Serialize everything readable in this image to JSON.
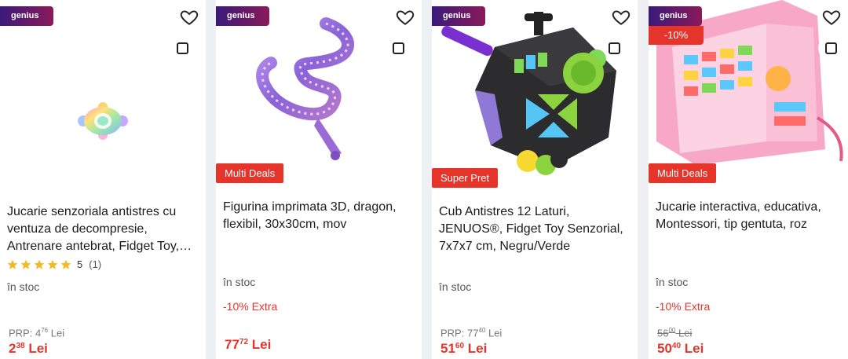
{
  "common": {
    "genius_label": "genius",
    "in_stock": "în stoc",
    "currency": "Lei",
    "prp_label": "PRP:",
    "extra_label": "-10% Extra",
    "colors": {
      "accent": "#e5352b",
      "genius_start": "#3a1a7a",
      "genius_end": "#8a1a5a",
      "star": "#f5b921"
    }
  },
  "products": [
    {
      "title": "Jucarie senzoriala antistres cu ventuza de decompresie, Antrenare antebrat, Fidget Toy, Multicolor",
      "rating": "5",
      "rating_count": "(1)",
      "prp_int": "4",
      "prp_dec": "76",
      "price_int": "2",
      "price_dec": "38",
      "image": "rainbow-pop-fidget-image"
    },
    {
      "title": "Figurina imprimata 3D, dragon, flexibil, 30x30cm, mov",
      "badge": "Multi Deals",
      "price_int": "77",
      "price_dec": "72",
      "image": "purple-dragon-figurine-image"
    },
    {
      "title": "Cub Antistres 12 Laturi, JENUOS®, Fidget Toy Senzorial, 7x7x7 cm, Negru/Verde",
      "badge": "Super Pret",
      "prp_int": "77",
      "prp_dec": "40",
      "price_int": "51",
      "price_dec": "60",
      "image": "fidget-cube-image"
    },
    {
      "title": "Jucarie interactiva, educativa, Montessori, tip gentuta, roz",
      "badge": "Multi Deals",
      "discount": "-10%",
      "old_int": "56",
      "old_dec": "00",
      "price_int": "50",
      "price_dec": "40",
      "image": "pink-busy-board-image"
    }
  ]
}
